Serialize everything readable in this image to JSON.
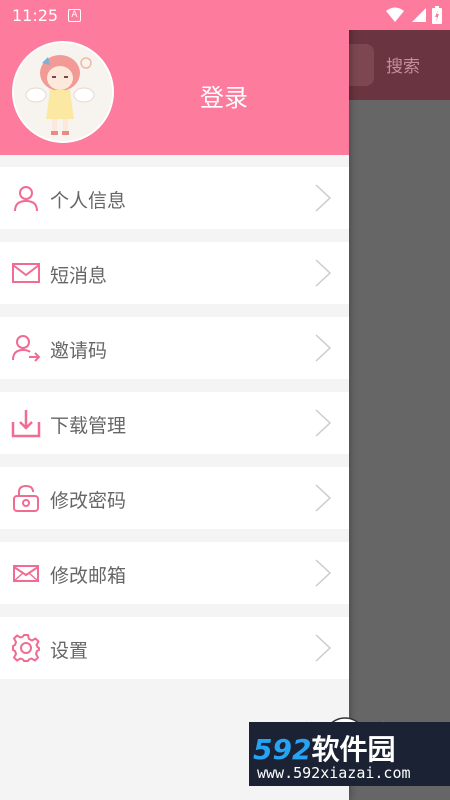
{
  "status_bar": {
    "time": "11:25",
    "notification_icon": "A"
  },
  "background": {
    "search_button_label": "搜索"
  },
  "drawer": {
    "header": {
      "title": "登录"
    },
    "menu": [
      {
        "icon": "person-icon",
        "label": "个人信息"
      },
      {
        "icon": "envelope-icon",
        "label": "短消息"
      },
      {
        "icon": "invite-user-icon",
        "label": "邀请码"
      },
      {
        "icon": "download-tray-icon",
        "label": "下载管理"
      },
      {
        "icon": "lock-icon",
        "label": "修改密码"
      },
      {
        "icon": "mail-icon",
        "label": "修改邮箱"
      },
      {
        "icon": "gear-icon",
        "label": "设置"
      }
    ]
  },
  "watermark": {
    "brand_number": "592",
    "brand_text": "软件园",
    "url": "www.592xiazai.com"
  },
  "colors": {
    "accent_pink": "#fd7b9c",
    "icon_pink": "#f06c93",
    "chevron_gray": "#cccccc",
    "scrim": "#666666"
  }
}
